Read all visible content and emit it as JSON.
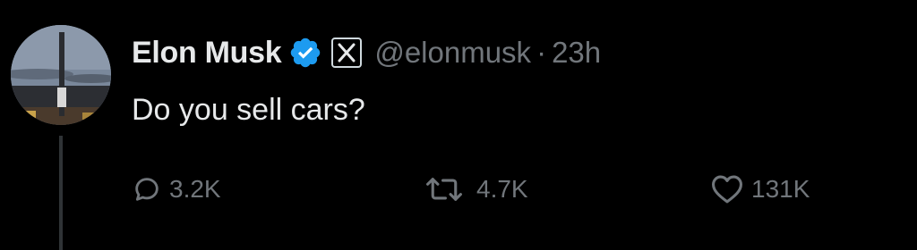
{
  "tweet": {
    "author_name": "Elon Musk",
    "handle": "@elonmusk",
    "separator": "·",
    "timestamp": "23h",
    "text": "Do you sell cars?",
    "verified_icon": "verified-badge-icon",
    "affiliation_icon": "x-logo-icon"
  },
  "actions": {
    "reply": {
      "icon": "reply-bubble-icon",
      "count": "3.2K"
    },
    "repost": {
      "icon": "repost-icon",
      "count": "4.7K"
    },
    "like": {
      "icon": "heart-icon",
      "count": "131K"
    }
  },
  "colors": {
    "background": "#000000",
    "primary_text": "#e7e9ea",
    "secondary_text": "#71767b",
    "verified_blue": "#1d9bf0"
  }
}
